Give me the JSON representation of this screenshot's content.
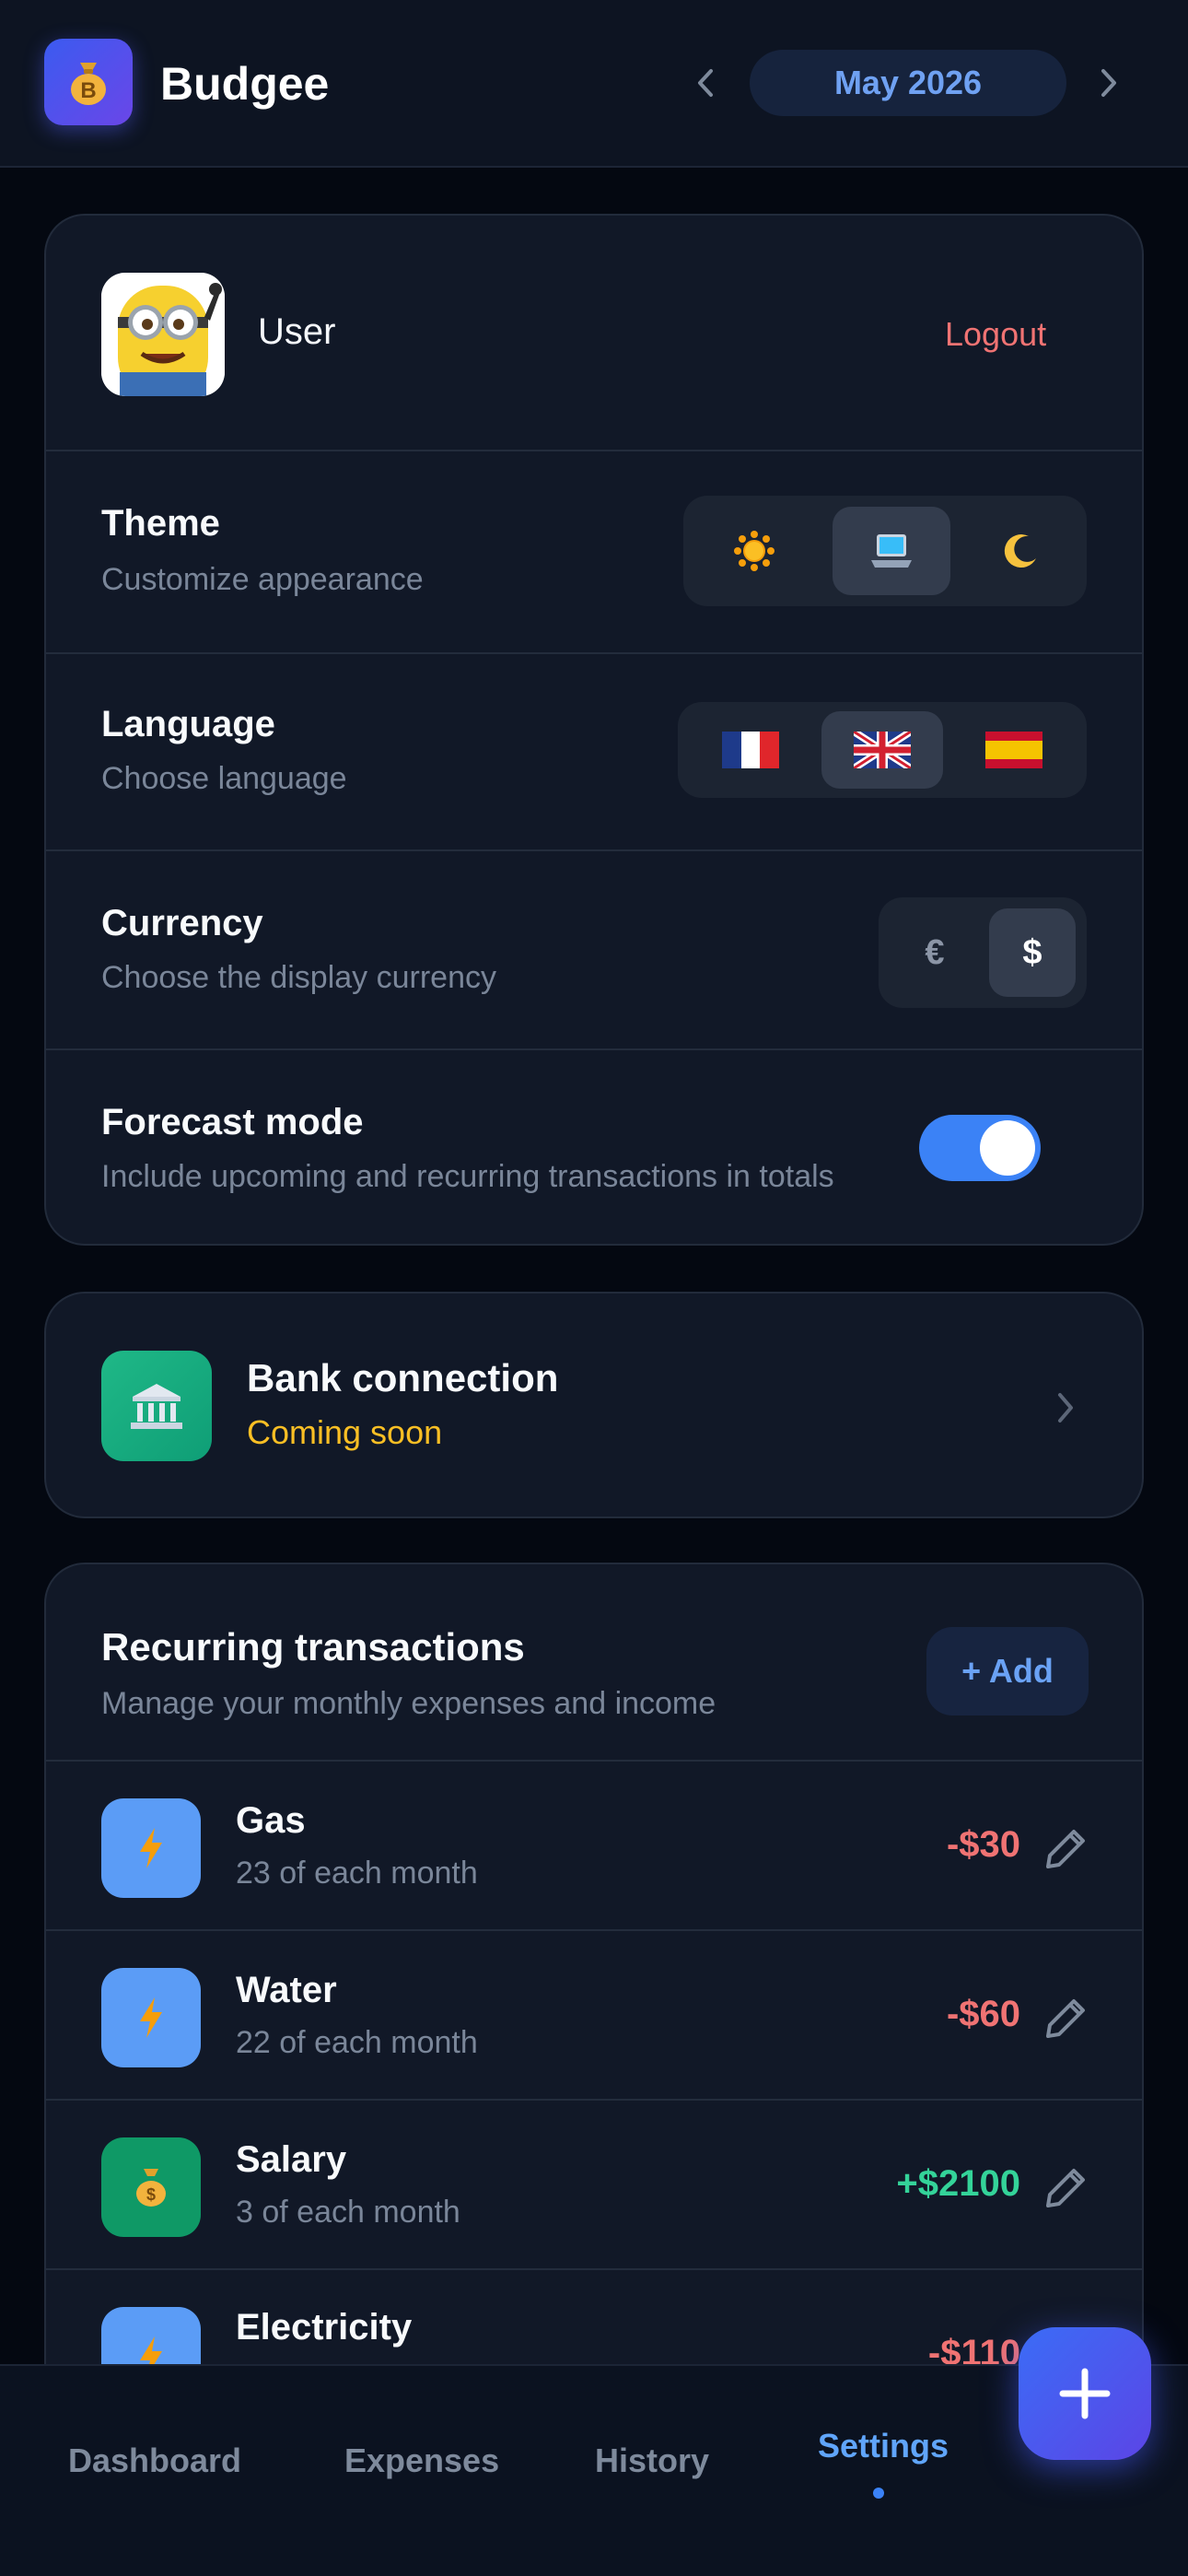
{
  "header": {
    "app_name": "Budgee",
    "logo_letter": "B",
    "month_label": "May 2026"
  },
  "profile": {
    "user_name": "User",
    "logout_label": "Logout"
  },
  "settings": {
    "theme": {
      "title": "Theme",
      "subtitle": "Customize appearance",
      "options": [
        "light",
        "system",
        "dark"
      ],
      "selected": "system"
    },
    "language": {
      "title": "Language",
      "subtitle": "Choose language",
      "options": [
        "fr",
        "en",
        "es"
      ],
      "selected": "en"
    },
    "currency": {
      "title": "Currency",
      "subtitle": "Choose the display currency",
      "options": [
        "€",
        "$"
      ],
      "selected": "$"
    },
    "forecast": {
      "title": "Forecast mode",
      "subtitle": "Include upcoming and recurring transactions in totals",
      "enabled": true
    }
  },
  "bank": {
    "title": "Bank connection",
    "status": "Coming soon"
  },
  "recurring": {
    "title": "Recurring transactions",
    "subtitle": "Manage your monthly expenses and income",
    "add_label": "+ Add",
    "items": [
      {
        "name": "Gas",
        "schedule": "23 of each month",
        "amount": "-$30",
        "kind": "expense",
        "icon": "lightning-icon"
      },
      {
        "name": "Water",
        "schedule": "22 of each month",
        "amount": "-$60",
        "kind": "expense",
        "icon": "lightning-icon"
      },
      {
        "name": "Salary",
        "schedule": "3 of each month",
        "amount": "+$2100",
        "kind": "income",
        "icon": "money-bag-icon"
      },
      {
        "name": "Electricity",
        "schedule": "",
        "amount": "-$110",
        "kind": "expense",
        "icon": "lightning-icon"
      }
    ]
  },
  "nav": {
    "items": [
      "Dashboard",
      "Expenses",
      "History",
      "Settings"
    ],
    "active": "Settings"
  },
  "colors": {
    "accent": "#3b82f6",
    "expense": "#f07373",
    "income": "#34d399",
    "warning": "#fbbf24"
  }
}
